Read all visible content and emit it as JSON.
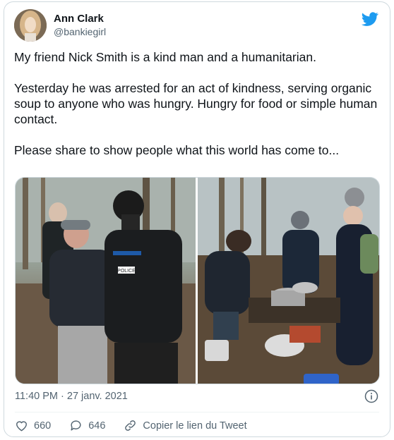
{
  "author": {
    "name": "Ann Clark",
    "handle": "@bankiegirl"
  },
  "tweet": {
    "paragraphs": [
      "My friend Nick Smith is a kind man and a humanitarian.",
      "Yesterday he was arrested for an act of kindness, serving organic soup to anyone who was hungry.  Hungry for food or simple human contact.",
      "Please share to show people what this world has come to..."
    ]
  },
  "media": {
    "photos": [
      {
        "police_label": "POLICE"
      },
      {}
    ]
  },
  "meta": {
    "timestamp": "11:40 PM · 27 janv. 2021"
  },
  "actions": {
    "likes": "660",
    "replies": "646",
    "copy_link": "Copier le lien du Tweet"
  },
  "colors": {
    "twitter_blue": "#1d9bf0",
    "secondary_text": "#536471",
    "primary_text": "#0f1419",
    "border": "#cfd9de"
  },
  "icons": [
    "twitter-bird-icon",
    "info-icon",
    "heart-icon",
    "reply-icon",
    "link-icon"
  ]
}
